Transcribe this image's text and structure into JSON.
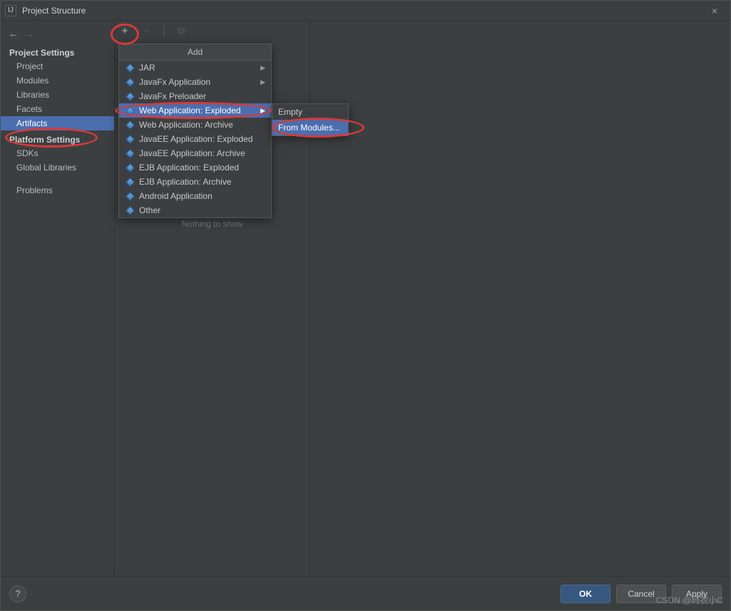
{
  "titlebar": {
    "icon": "IJ",
    "title": "Project Structure",
    "close": "×"
  },
  "nav": {
    "back": "←",
    "forward": "→"
  },
  "sidebar": {
    "section1_title": "Project Settings",
    "items1": [
      {
        "label": "Project"
      },
      {
        "label": "Modules"
      },
      {
        "label": "Libraries"
      },
      {
        "label": "Facets"
      },
      {
        "label": "Artifacts"
      }
    ],
    "section2_title": "Platform Settings",
    "items2": [
      {
        "label": "SDKs"
      },
      {
        "label": "Global Libraries"
      }
    ],
    "items3": [
      {
        "label": "Problems"
      }
    ]
  },
  "toolbar": {
    "add": "+",
    "remove": "−",
    "copy_icon": "⧉"
  },
  "list": {
    "empty": "Nothing to show"
  },
  "addMenu": {
    "title": "Add",
    "items": [
      {
        "label": "JAR",
        "sub": true
      },
      {
        "label": "JavaFx Application",
        "sub": true
      },
      {
        "label": "JavaFx Preloader"
      },
      {
        "label": "Web Application: Exploded",
        "sub": true,
        "selected": true
      },
      {
        "label": "Web Application: Archive"
      },
      {
        "label": "JavaEE Application: Exploded"
      },
      {
        "label": "JavaEE Application: Archive"
      },
      {
        "label": "EJB Application: Exploded"
      },
      {
        "label": "EJB Application: Archive"
      },
      {
        "label": "Android Application"
      },
      {
        "label": "Other"
      }
    ]
  },
  "subMenu": {
    "items": [
      {
        "label": "Empty"
      },
      {
        "label": "From Modules...",
        "selected": true
      }
    ]
  },
  "buttons": {
    "help": "?",
    "ok": "OK",
    "cancel": "Cancel",
    "apply": "Apply"
  },
  "watermark": "CSDN @码农小C"
}
